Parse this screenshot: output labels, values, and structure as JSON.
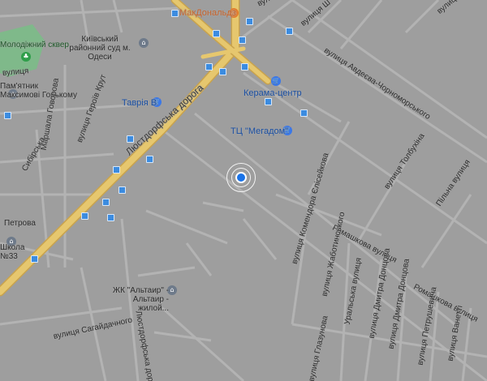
{
  "map": {
    "colors": {
      "land": "#9e9e9e",
      "street": "#b3b3b3",
      "highway": "#e0c06a",
      "park": "#7fb98a",
      "poi_blue": "#3b78e7",
      "location": "#1a73e8"
    },
    "labels": {
      "mcdonalds": "МакДональдз",
      "street_top_center": "вулиця",
      "street_top_right": "вулиця Ш",
      "street_far_right": "вулиця Генерала",
      "park": "Молодіжний сквер",
      "court": "Київський районний суд м. Одеси",
      "monument": "Пам'ятник Максимові Горькому",
      "keramа": "Керама-центр",
      "tavria": "Таврія В",
      "megadom": "ТЦ \"Мегадом\"",
      "ljustdorfska_road": "Люстдорфська дорога",
      "ljustdorfska_road_bottom": "Люстдорфська дорога",
      "avdeeva": "вулиця Авдеєва-Чорноморського",
      "tolbukhina": "вулиця Толбухіна",
      "polevaya": "Пільна вулиця",
      "heroiv_krut": "вулиця Героїв Крут",
      "mashtova": "Маршала Говорова",
      "sibirska": "Сибірська",
      "petrova": "Петрова",
      "school": "Школа №33",
      "komandorov": "вулиця Комендора Єлісейкова",
      "romashkova1": "Ромашкова вулиця",
      "romashkova2": "Ромашкова вулиця",
      "zhabotynskoho": "вулиця Жаботинського",
      "uralska": "Уральська вулиця",
      "dmytra_dontsova": "вулиця Дмитра Донцова",
      "dmytra_dontsova2": "вулиця Дмитра Донцова",
      "petrushevycha": "вулиця Петрушевича",
      "vanetti": "вулиця Ванетті",
      "hlazunova": "вулиця Глазунова",
      "sahaidachnoho": "вулиця Сагайдачного",
      "altair": "ЖК \"Альтаир\" - Альтаир - жилой...",
      "left_street": "вулиця"
    }
  }
}
